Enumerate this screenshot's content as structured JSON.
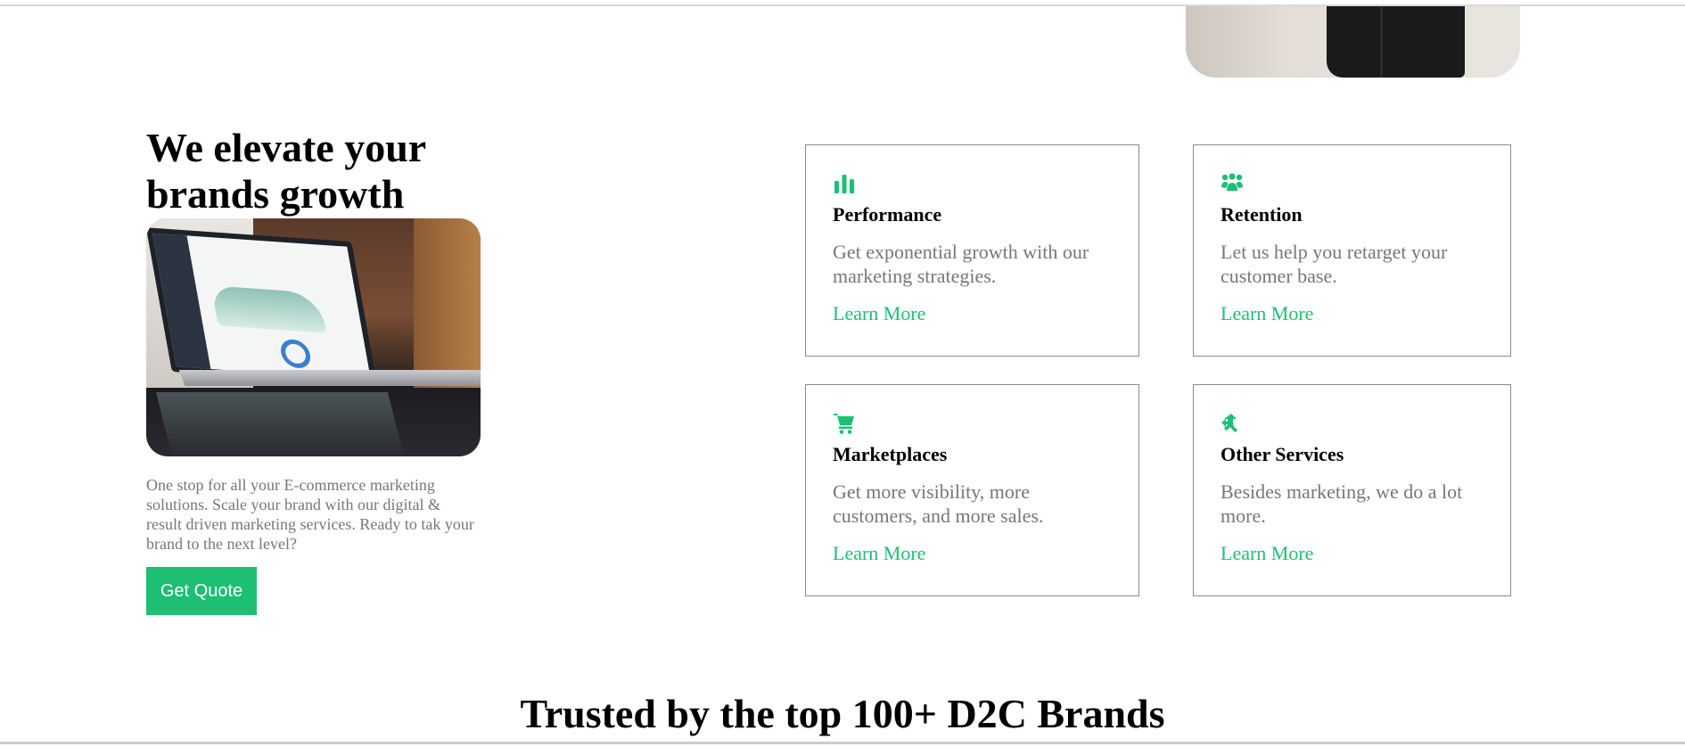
{
  "intro": {
    "heading": "We elevate your brands growth",
    "text": "One stop for all your E-commerce marketing solutions. Scale your brand with our digital & result driven marketing services. Ready to tak your brand to the next level?",
    "button": "Get Quote"
  },
  "services": [
    {
      "icon": "bar-chart-icon",
      "title": "Performance",
      "desc": "Get exponential growth with our marketing strategies.",
      "link": "Learn More"
    },
    {
      "icon": "users-group-icon",
      "title": "Retention",
      "desc": "Let us help you retarget your customer base.",
      "link": "Learn More"
    },
    {
      "icon": "shopping-cart-icon",
      "title": "Marketplaces",
      "desc": "Get more visibility, more customers, and more sales.",
      "link": "Learn More"
    },
    {
      "icon": "split-arrow-icon",
      "title": "Other Services",
      "desc": "Besides marketing, we do a lot more.",
      "link": "Learn More"
    }
  ],
  "trusted": {
    "heading": "Trusted by the top 100+ D2C Brands"
  },
  "colors": {
    "accent": "#1dbf73",
    "muted_text": "#777777",
    "card_border": "#8a8a8a"
  }
}
